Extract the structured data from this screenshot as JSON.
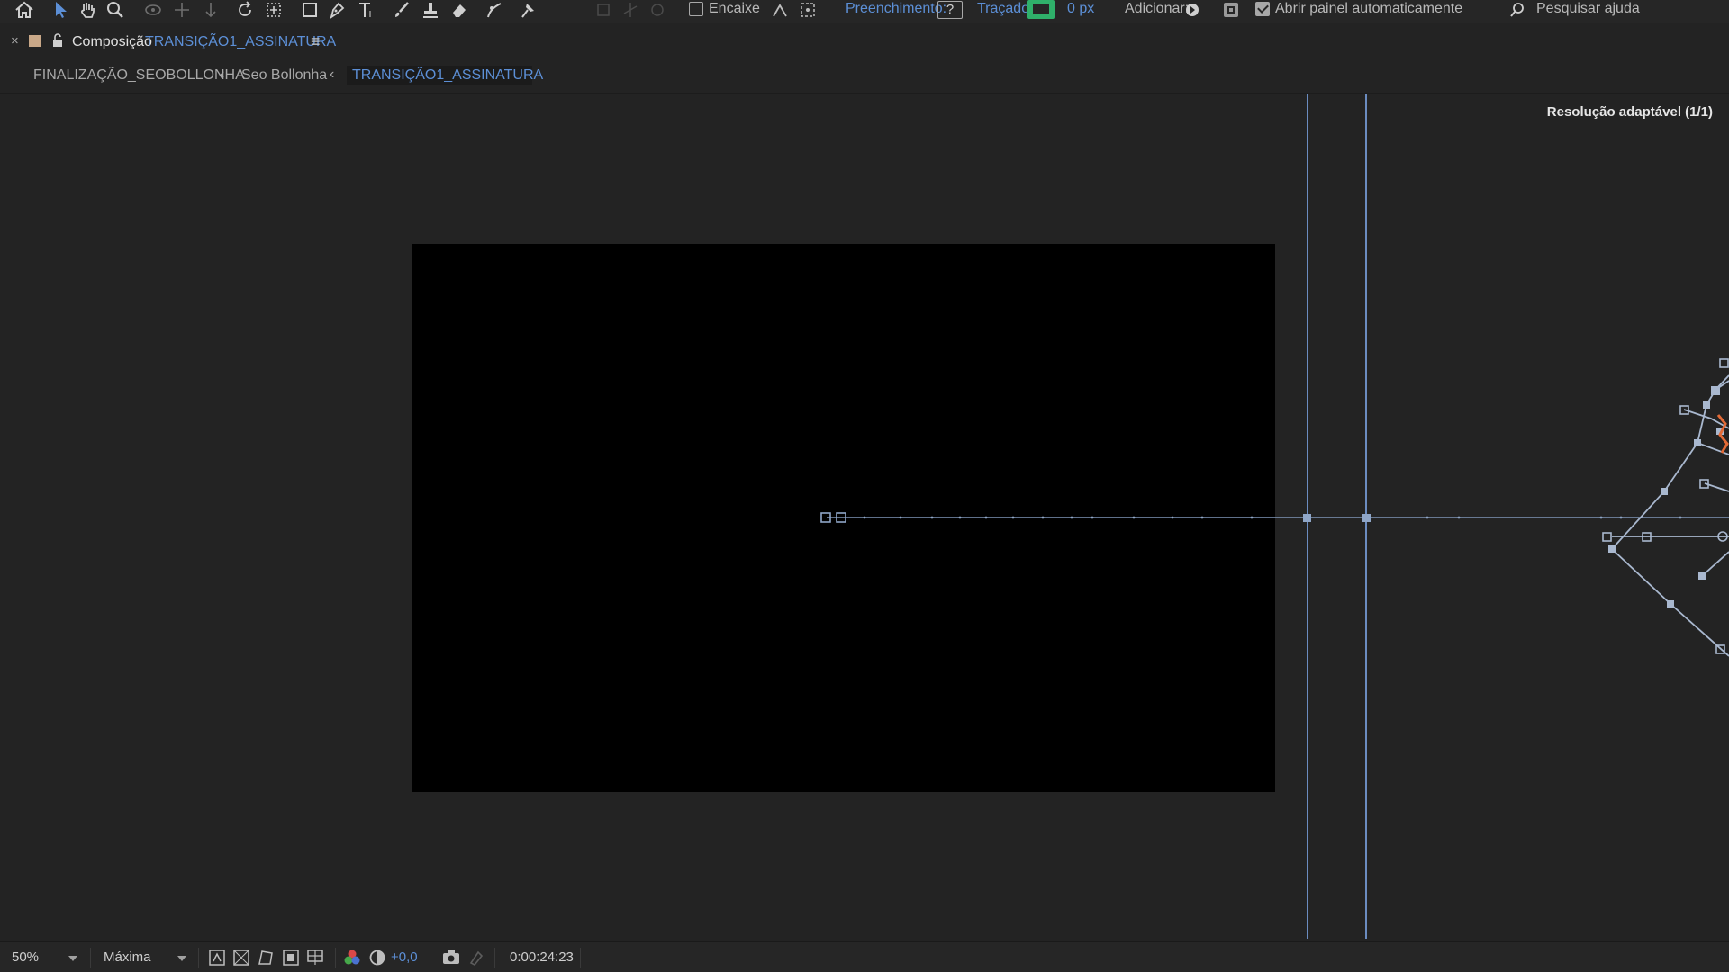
{
  "toolbar": {
    "snapping_label": "Encaixe",
    "fill_label": "Preenchimento:",
    "fill_value": "?",
    "stroke_label": "Traçado:",
    "stroke_width": "0 px",
    "add_label": "Adicionar:",
    "auto_open_label": "Abrir painel automaticamente",
    "search_help": "Pesquisar ajuda",
    "icons": [
      "home-icon",
      "selection-tool-icon",
      "hand-tool-icon",
      "zoom-tool-icon",
      "orbit-camera-icon",
      "pan-camera-icon",
      "dolly-camera-icon",
      "rotation-tool-icon",
      "anchor-point-tool-icon",
      "rectangle-tool-icon",
      "pen-tool-icon",
      "type-tool-icon",
      "brush-tool-icon",
      "clone-stamp-icon",
      "eraser-tool-icon",
      "roto-brush-icon",
      "puppet-pin-icon"
    ]
  },
  "panel": {
    "close_symbol": "×",
    "title_prefix": "Composição",
    "comp_name": "TRANSIÇÃO1_ASSINATURA",
    "menu_symbol": "≡"
  },
  "breadcrumb": {
    "items": [
      "FINALIZAÇÃO_SEOBOLLONHA",
      "Seo Bollonha",
      "TRANSIÇÃO1_ASSINATURA"
    ],
    "separator": "‹"
  },
  "viewer": {
    "resolution_label": "Resolução adaptável (1/1)"
  },
  "bottom_bar": {
    "zoom": "50%",
    "quality": "Máxima",
    "exposure": "+0,0",
    "timecode": "0:00:24:23"
  },
  "colors": {
    "accent_blue": "#5c8fd6",
    "stroke_green": "#2fb06a",
    "path_line": "#8fa6c7",
    "guide_line": "#6b8cc0",
    "panel_bg": "#232323"
  }
}
